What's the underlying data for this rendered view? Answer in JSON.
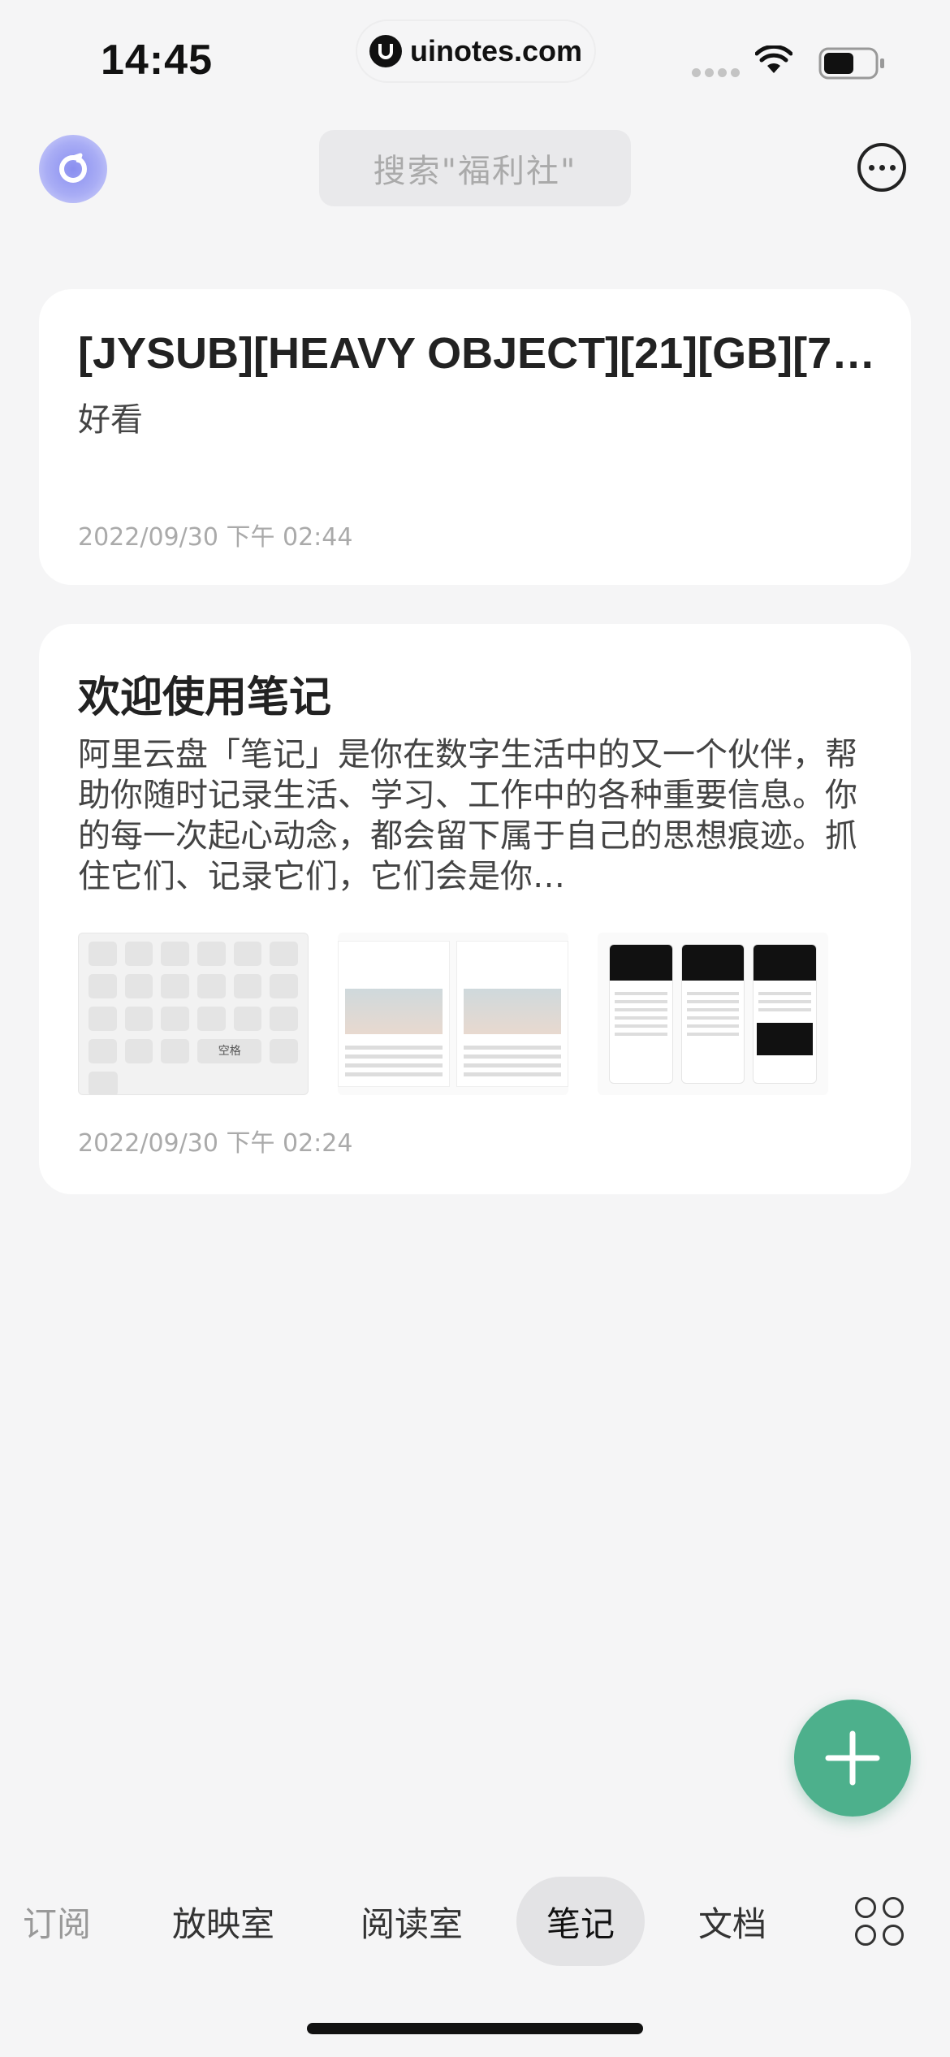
{
  "status_bar": {
    "time": "14:45",
    "url": "uinotes.com",
    "icons": [
      "signal-icon",
      "wifi-icon",
      "battery-icon"
    ]
  },
  "header": {
    "avatar_icon": "app-logo-icon",
    "search_placeholder": "搜索\"福利社\"",
    "more_icon": "more-icon"
  },
  "notes": [
    {
      "title": "[JYSUB][HEAVY OBJECT][21][GB][7…",
      "body": "好看",
      "date": "2022/09/30 下午 02:44"
    },
    {
      "title": "欢迎使用笔记",
      "body": "阿里云盘「笔记」是你在数字生活中的又一个伙伴，帮助你随时记录生活、学习、工作中的各种重要信息。你的每一次起心动念，都会留下属于自己的思想痕迹。抓住它们、记录它们，它们会是你…",
      "date": "2022/09/30 下午 02:24",
      "thumbnail_label": "空格"
    }
  ],
  "fab": {
    "icon": "plus-icon"
  },
  "tabs": [
    {
      "label": "订阅",
      "active": false
    },
    {
      "label": "放映室",
      "active": false
    },
    {
      "label": "阅读室",
      "active": false
    },
    {
      "label": "笔记",
      "active": true
    },
    {
      "label": "文档",
      "active": false
    },
    {
      "icon": "grid-icon"
    }
  ],
  "colors": {
    "background": "#f5f5f6",
    "fab": "#4db08c",
    "active_tab": "#e3e3e5"
  }
}
